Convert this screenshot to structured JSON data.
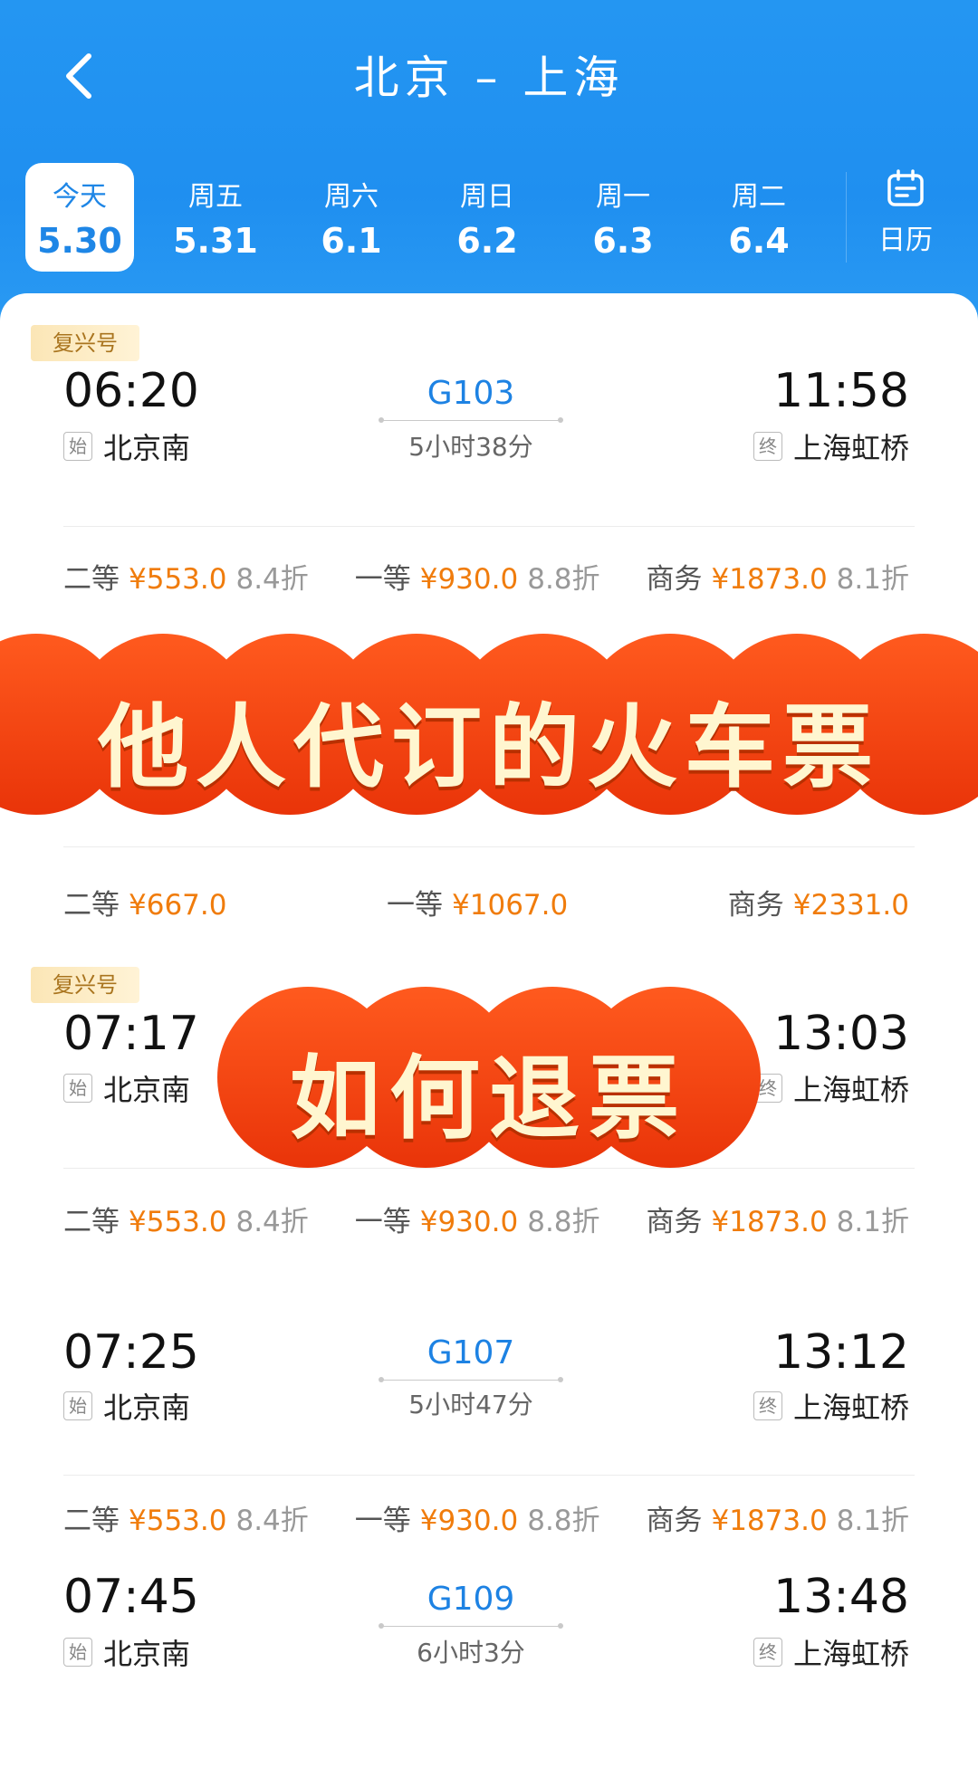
{
  "header": {
    "title": "北京 – 上海",
    "back_icon": "chevron-left-icon",
    "dates": [
      {
        "weekday": "今天",
        "date": "5.30",
        "active": true
      },
      {
        "weekday": "周五",
        "date": "5.31"
      },
      {
        "weekday": "周六",
        "date": "6.1"
      },
      {
        "weekday": "周日",
        "date": "6.2"
      },
      {
        "weekday": "周一",
        "date": "6.3"
      },
      {
        "weekday": "周二",
        "date": "6.4"
      }
    ],
    "calendar_label": "日历",
    "calendar_icon": "calendar-icon"
  },
  "trains": [
    {
      "badge": "复兴号",
      "dep_time": "06:20",
      "dep_tag": "始",
      "dep_station": "北京南",
      "train_no": "G103",
      "duration": "5小时38分",
      "arr_time": "11:58",
      "arr_tag": "终",
      "arr_station": "上海虹桥",
      "prices": [
        {
          "cls": "二等",
          "amt": "¥553.0",
          "disc": "8.4折"
        },
        {
          "cls": "一等",
          "amt": "¥930.0",
          "disc": "8.8折"
        },
        {
          "cls": "商务",
          "amt": "¥1873.0",
          "disc": "8.1折"
        }
      ]
    },
    {
      "prices": [
        {
          "cls": "二等",
          "amt": "¥667.0"
        },
        {
          "cls": "一等",
          "amt": "¥1067.0"
        },
        {
          "cls": "商务",
          "amt": "¥2331.0"
        }
      ]
    },
    {
      "badge": "复兴号",
      "dep_time": "07:17",
      "dep_tag": "始",
      "dep_station": "北京南",
      "arr_time": "13:03",
      "arr_tag": "终",
      "arr_station": "上海虹桥",
      "prices": [
        {
          "cls": "二等",
          "amt": "¥553.0",
          "disc": "8.4折"
        },
        {
          "cls": "一等",
          "amt": "¥930.0",
          "disc": "8.8折"
        },
        {
          "cls": "商务",
          "amt": "¥1873.0",
          "disc": "8.1折"
        }
      ]
    },
    {
      "dep_time": "07:25",
      "dep_tag": "始",
      "dep_station": "北京南",
      "train_no": "G107",
      "duration": "5小时47分",
      "arr_time": "13:12",
      "arr_tag": "终",
      "arr_station": "上海虹桥",
      "prices": [
        {
          "cls": "二等",
          "amt": "¥553.0",
          "disc": "8.4折"
        },
        {
          "cls": "一等",
          "amt": "¥930.0",
          "disc": "8.8折"
        },
        {
          "cls": "商务",
          "amt": "¥1873.0",
          "disc": "8.1折"
        }
      ]
    },
    {
      "dep_time": "07:45",
      "dep_tag": "始",
      "dep_station": "北京南",
      "train_no": "G109",
      "duration": "6小时3分",
      "arr_time": "13:48",
      "arr_tag": "终",
      "arr_station": "上海虹桥"
    }
  ],
  "overlays": {
    "banner_1": "他人代订的火车票",
    "banner_2": "如何退票",
    "banner_color": "#f2400f"
  },
  "colors": {
    "header_blue": "#2496f2",
    "price_orange": "#f07c0c",
    "train_blue": "#1d82e3"
  }
}
